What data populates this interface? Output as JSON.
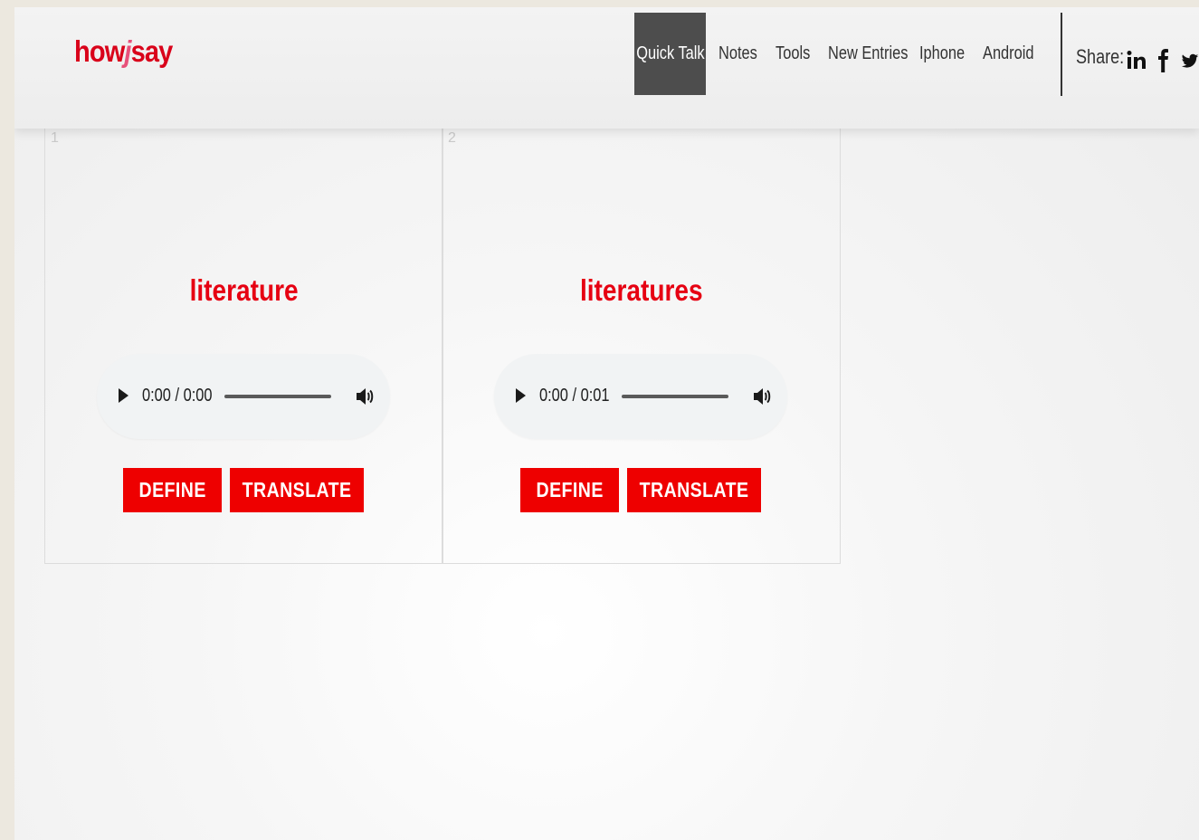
{
  "brand": {
    "prefix": "how",
    "middle": "j",
    "suffix": "say"
  },
  "nav": {
    "items": [
      {
        "label": "Quick Talk",
        "active": true
      },
      {
        "label": "Notes",
        "active": false
      },
      {
        "label": "Tools",
        "active": false
      },
      {
        "label": "New Entries",
        "active": false
      },
      {
        "label": "Iphone",
        "active": false
      },
      {
        "label": "Android",
        "active": false
      }
    ]
  },
  "share": {
    "label": "Share:",
    "icons": [
      "linkedin-icon",
      "facebook-icon",
      "twitter-icon"
    ]
  },
  "cards": [
    {
      "number": "1",
      "word": "literature",
      "audio_time": "0:00 / 0:00",
      "define_label": "DEFINE",
      "translate_label": "TRANSLATE"
    },
    {
      "number": "2",
      "word": "literatures",
      "audio_time": "0:00 / 0:01",
      "define_label": "DEFINE",
      "translate_label": "TRANSLATE"
    }
  ],
  "colors": {
    "brand_red": "#d9021a",
    "button_red": "#ee0000",
    "active_nav": "#4d4d4d"
  }
}
